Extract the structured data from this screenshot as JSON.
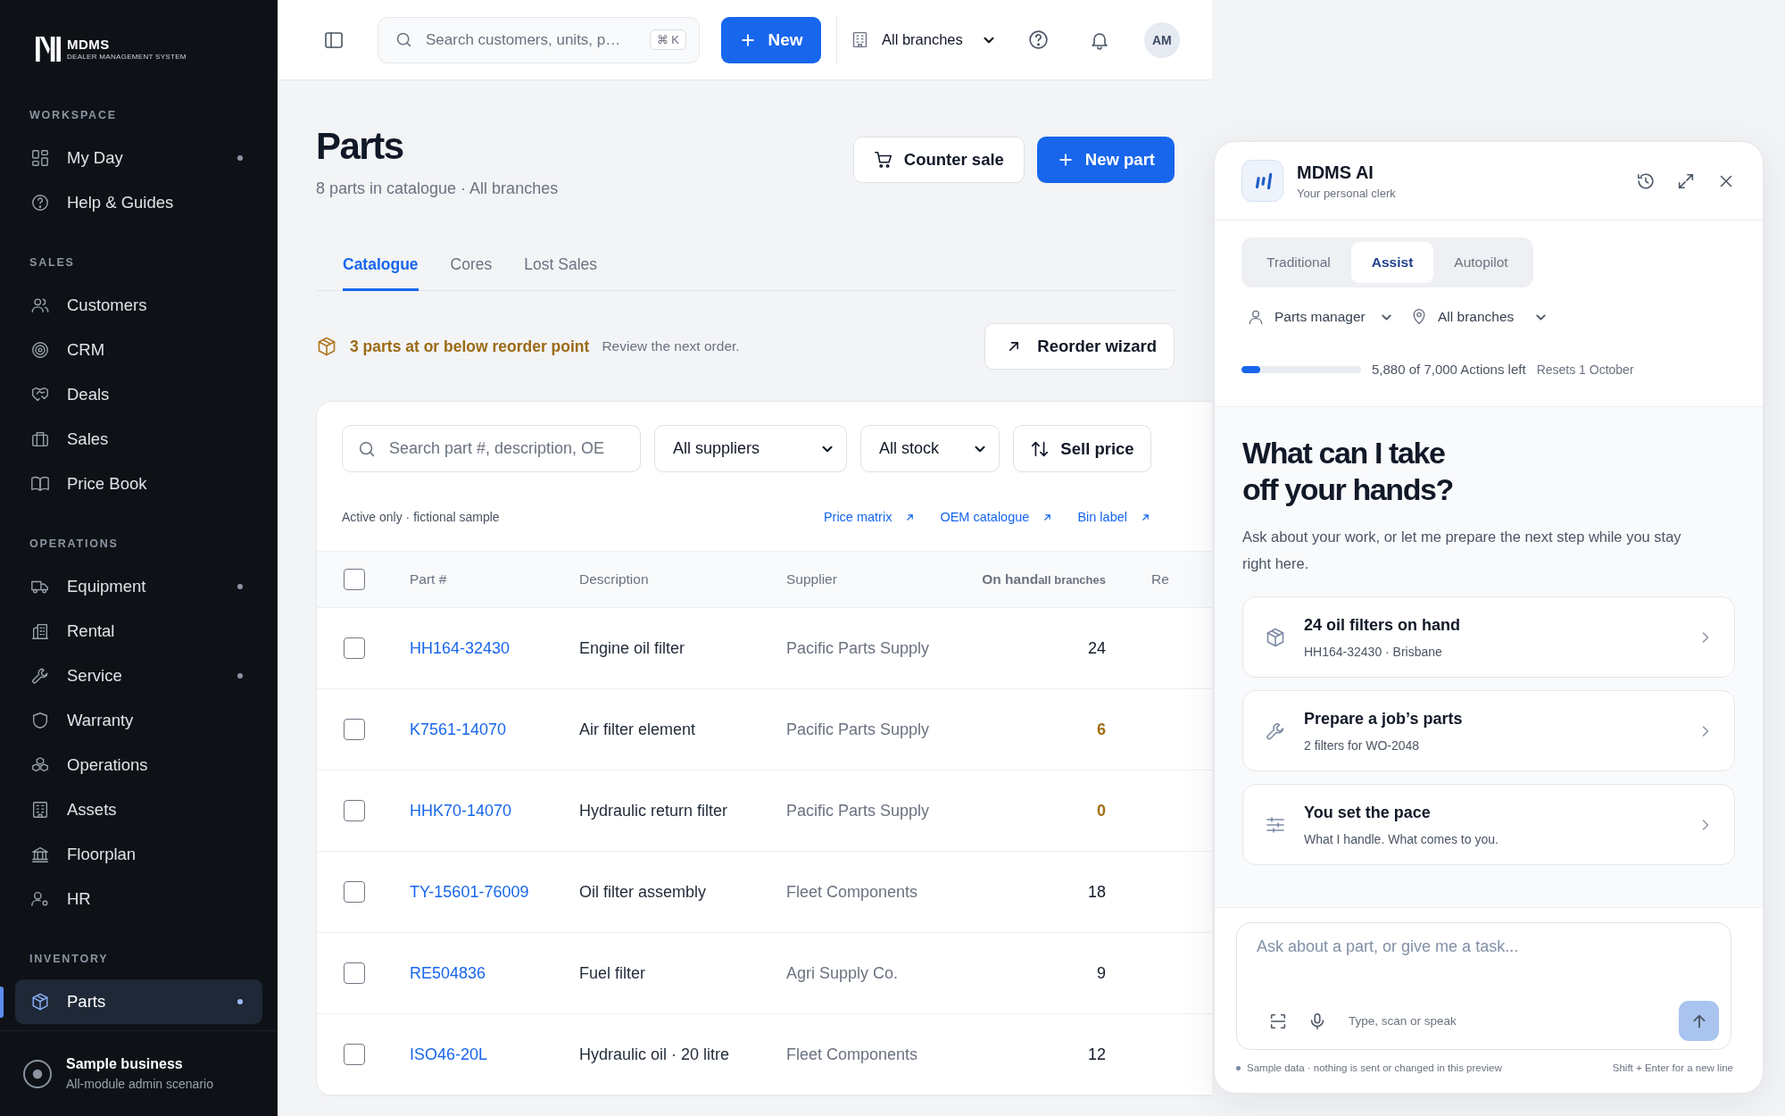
{
  "sidebar": {
    "brand": {
      "name": "MDMS",
      "tagline": "DEALER MANAGEMENT SYSTEM"
    },
    "sections": [
      {
        "title": "WORKSPACE",
        "items": [
          {
            "label": "My Day",
            "selected": false,
            "dot": true
          },
          {
            "label": "Help & Guides",
            "selected": false,
            "dot": false
          }
        ]
      },
      {
        "title": "SALES",
        "items": [
          {
            "label": "Customers",
            "selected": false,
            "dot": false
          },
          {
            "label": "CRM",
            "selected": false,
            "dot": false
          },
          {
            "label": "Deals",
            "selected": false,
            "dot": false
          },
          {
            "label": "Sales",
            "selected": false,
            "dot": false
          },
          {
            "label": "Price Book",
            "selected": false,
            "dot": false
          }
        ]
      },
      {
        "title": "OPERATIONS",
        "items": [
          {
            "label": "Equipment",
            "selected": false,
            "dot": true
          },
          {
            "label": "Rental",
            "selected": false,
            "dot": false
          },
          {
            "label": "Service",
            "selected": false,
            "dot": true
          },
          {
            "label": "Warranty",
            "selected": false,
            "dot": false
          },
          {
            "label": "Operations",
            "selected": false,
            "dot": false
          },
          {
            "label": "Assets",
            "selected": false,
            "dot": false
          },
          {
            "label": "Floorplan",
            "selected": false,
            "dot": false
          },
          {
            "label": "HR",
            "selected": false,
            "dot": false
          }
        ]
      },
      {
        "title": "INVENTORY",
        "items": [
          {
            "label": "Parts",
            "selected": true,
            "dot": true
          }
        ]
      }
    ],
    "footer": {
      "title": "Sample business",
      "subtitle": "All-module admin scenario"
    }
  },
  "topbar": {
    "search": {
      "placeholder": "Search customers, units, p…",
      "shortcut": "⌘ K"
    },
    "new_button": "New",
    "branch_picker": "All branches",
    "avatar": "AM"
  },
  "page": {
    "title": "Parts",
    "subtitle": "8 parts in catalogue · All branches",
    "actions": [
      {
        "label": "Counter sale",
        "kind": "secondary"
      },
      {
        "label": "New part",
        "kind": "primary"
      }
    ],
    "tabs": [
      {
        "label": "Catalogue",
        "selected": true
      },
      {
        "label": "Cores",
        "selected": false
      },
      {
        "label": "Lost Sales",
        "selected": false
      }
    ],
    "alert": {
      "title": "3 parts at or below reorder point",
      "text": "Review the next order.",
      "button": "Reorder wizard"
    },
    "filters": {
      "search_placeholder": "Search part #, description, OE",
      "supplier": "All suppliers",
      "stock": "All stock",
      "sort": "Sell price"
    },
    "note": "Active only · fictional sample",
    "links": [
      "Price matrix",
      "OEM catalogue",
      "Bin label"
    ],
    "table": {
      "header_checked": false,
      "columns": [
        {
          "label": "Part #"
        },
        {
          "label": "Description"
        },
        {
          "label": "Supplier"
        },
        {
          "label": "On hand",
          "sublabel": "all branches"
        },
        {
          "label": "Re"
        }
      ],
      "rows": [
        {
          "checked": false,
          "part": "HH164-32430",
          "description": "Engine oil filter",
          "supplier": "Pacific Parts Supply",
          "on_hand": "24",
          "low": false
        },
        {
          "checked": false,
          "part": "K7561-14070",
          "description": "Air filter element",
          "supplier": "Pacific Parts Supply",
          "on_hand": "6",
          "low": true
        },
        {
          "checked": false,
          "part": "HHK70-14070",
          "description": "Hydraulic return filter",
          "supplier": "Pacific Parts Supply",
          "on_hand": "0",
          "low": true
        },
        {
          "checked": false,
          "part": "TY-15601-76009",
          "description": "Oil filter assembly",
          "supplier": "Fleet Components",
          "on_hand": "18",
          "low": false
        },
        {
          "checked": false,
          "part": "RE504836",
          "description": "Fuel filter",
          "supplier": "Agri Supply Co.",
          "on_hand": "9",
          "low": false
        },
        {
          "checked": false,
          "part": "ISO46-20L",
          "description": "Hydraulic oil · 20 litre",
          "supplier": "Fleet Components",
          "on_hand": "12",
          "low": false
        }
      ]
    }
  },
  "assistant": {
    "title": "MDMS AI",
    "subtitle": "Your personal clerk",
    "modes": [
      {
        "label": "Traditional",
        "selected": false
      },
      {
        "label": "Assist",
        "selected": true
      },
      {
        "label": "Autopilot",
        "selected": false
      }
    ],
    "role": "Parts manager",
    "branch": "All branches",
    "usage": {
      "level": 0.16,
      "text": "5,880 of 7,000 Actions left",
      "reset": "Resets 1 October"
    },
    "heading": "What can I take off your hands?",
    "intro": "Ask about your work, or let me prepare the next step while you stay right here.",
    "suggestions": [
      {
        "title": "24 oil filters on hand",
        "subtitle": "HH164-32430 · Brisbane"
      },
      {
        "title": "Prepare a job’s parts",
        "subtitle": "2 filters for WO-2048"
      },
      {
        "title": "You set the pace",
        "subtitle": "What I handle. What comes to you."
      }
    ],
    "composer": {
      "placeholder": "Ask about a part, or give me a task...",
      "hint": "Type, scan or speak",
      "send_disabled": true
    },
    "footer_note": "Sample data · nothing is sent or changed in this preview",
    "shortcut_hint": "Shift + Enter for a new line"
  }
}
